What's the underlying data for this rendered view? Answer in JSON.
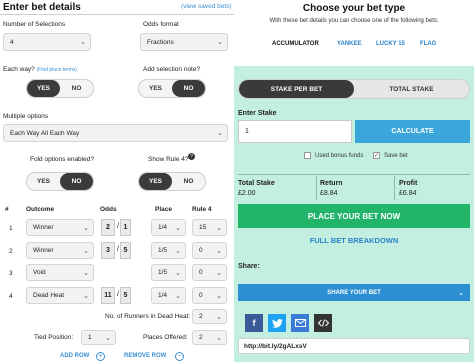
{
  "left": {
    "title": "Enter bet details",
    "view_saved": "(view saved bets)",
    "num_selections_label": "Number of Selections",
    "num_selections_value": "4",
    "odds_format_label": "Odds format",
    "odds_format_value": "Fractions",
    "each_way_label": "Each way?",
    "each_way_link": "(Find place terms)",
    "add_note_label": "Add selection note?",
    "yes": "YES",
    "no": "NO",
    "multiple_options_label": "Multiple options",
    "multiple_options_value": "Each Way All Each Way",
    "fold_label": "Fold options enabled?",
    "rule4_label": "Show Rule 4?",
    "info_glyph": "?",
    "headers": {
      "num": "#",
      "outcome": "Outcome",
      "odds": "Odds",
      "place": "Place",
      "rule4": "Rule 4"
    },
    "rows": [
      {
        "num": "1",
        "outcome": "Winner",
        "odds_n": "2",
        "odds_d": "1",
        "place": "1/4",
        "rule4": "15"
      },
      {
        "num": "2",
        "outcome": "Winner",
        "odds_n": "3",
        "odds_d": "5",
        "place": "1/5",
        "rule4": "0"
      },
      {
        "num": "3",
        "outcome": "Void",
        "odds_n": "",
        "odds_d": "",
        "place": "1/5",
        "rule4": "0"
      },
      {
        "num": "4",
        "outcome": "Dead Heat",
        "odds_n": "11",
        "odds_d": "5",
        "place": "1/4",
        "rule4": "0"
      }
    ],
    "slash": "/",
    "runners_label": "No. of Runners in Dead Heat:",
    "runners_value": "2",
    "tied_label": "Tied Position:",
    "tied_value": "1",
    "places_label": "Places Offered:",
    "places_value": "2",
    "add_row": "ADD ROW",
    "remove_row": "REMOVE ROW",
    "plus": "+",
    "minus": "−"
  },
  "right": {
    "title": "Choose your bet type",
    "subtitle": "With these bet details you can choose one of the following bets:",
    "tabs": [
      "ACCUMULATOR",
      "YANKEE",
      "LUCKY 15",
      "FLAG"
    ],
    "seg_left": "STAKE PER BET",
    "seg_right": "TOTAL STAKE",
    "enter_stake": "Enter Stake",
    "stake_value": "1",
    "calculate": "CALCULATE",
    "used_bonus": "Used bonus funds",
    "save_bet": "Save bet",
    "check": "✓",
    "total_stake_label": "Total Stake",
    "total_stake_value": "£2.00",
    "return_label": "Return",
    "return_value": "£8.84",
    "profit_label": "Profit",
    "profit_value": "£6.84",
    "place_bet": "PLACE YOUR BET NOW",
    "breakdown": "FULL BET BREAKDOWN",
    "share_label": "Share:",
    "share_btn": "SHARE YOUR BET",
    "url": "http://bit.ly/2gALxsV"
  },
  "colors": {
    "accent_blue": "#3aa6d9",
    "green_button": "#22b56a",
    "mint_panel": "#c3efe1",
    "facebook": "#3b5998",
    "twitter": "#1da1f2",
    "email": "#3a7bd5",
    "embed": "#333333"
  }
}
